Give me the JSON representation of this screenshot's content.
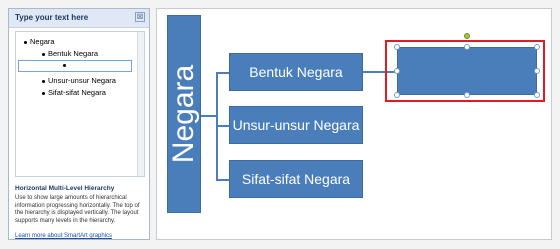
{
  "text_pane": {
    "title": "Type your text here",
    "close_glyph": "☒",
    "items": [
      {
        "text": "Negara",
        "level": 1
      },
      {
        "text": "Bentuk Negara",
        "level": 2
      },
      {
        "text": "",
        "level": 3
      },
      {
        "text": "Unsur-unsur Negara",
        "level": 2
      },
      {
        "text": "Sifat-sifat Negara",
        "level": 2
      }
    ],
    "description_title": "Horizontal Multi-Level Hierarchy",
    "description": "Use to show large amounts of hierarchical information progressing horizontally. The top of the hierarchy is displayed vertically. The layout supports many levels in the hierarchy.",
    "link_text": "Learn more about SmartArt graphics"
  },
  "diagram": {
    "title": "Negara",
    "nodes": [
      "Bentuk Negara",
      "Unsur-unsur Negara",
      "Sifat-sifat Negara"
    ],
    "new_node_text": ""
  },
  "colors": {
    "shape_fill": "#4a7ebb",
    "highlight": "#e01b24"
  }
}
